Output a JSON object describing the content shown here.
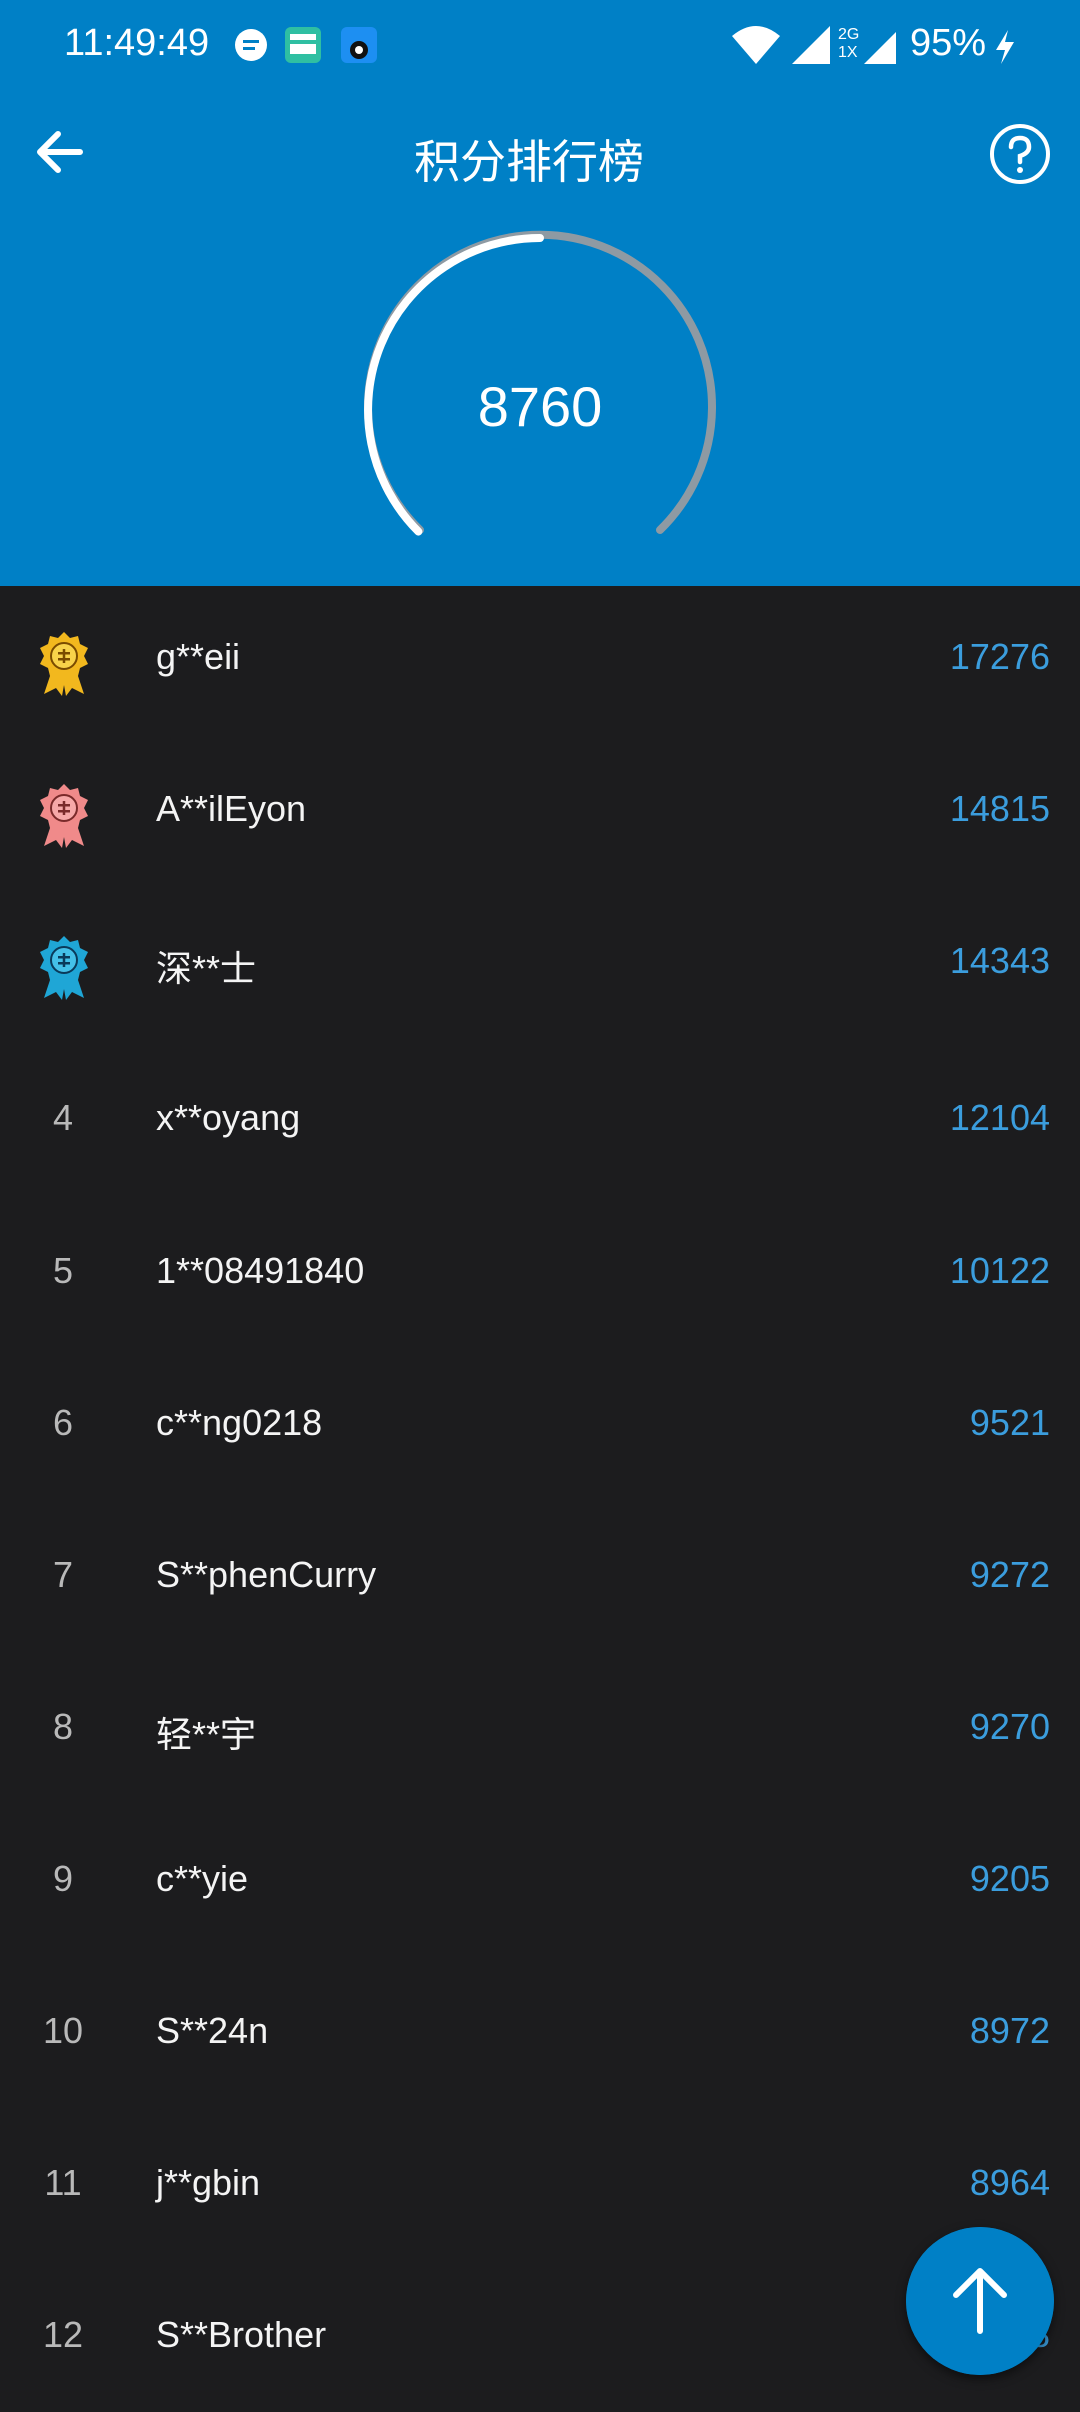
{
  "status_bar": {
    "time": "11:49:49",
    "battery": "95%",
    "network": "2G 1X",
    "icons": [
      "message-bubble-icon",
      "boss-app-icon",
      "app-618-icon",
      "wifi-icon",
      "signal-icon",
      "charging-icon"
    ]
  },
  "header": {
    "title": "积分排行榜",
    "back_icon": "arrow-left-icon",
    "help_icon": "question-circle-icon"
  },
  "score": {
    "value": "8760",
    "progress_fraction": 0.5
  },
  "leaderboard": {
    "rows": [
      {
        "rank": "1",
        "name": "g**eii",
        "points": "17276",
        "medal": "gold-medal-icon"
      },
      {
        "rank": "2",
        "name": "A**ilEyon",
        "points": "14815",
        "medal": "silver-medal-icon"
      },
      {
        "rank": "3",
        "name": "深**士",
        "points": "14343",
        "medal": "bronze-medal-icon"
      },
      {
        "rank": "4",
        "name": "x**oyang",
        "points": "12104"
      },
      {
        "rank": "5",
        "name": "1**08491840",
        "points": "10122"
      },
      {
        "rank": "6",
        "name": "c**ng0218",
        "points": "9521"
      },
      {
        "rank": "7",
        "name": "S**phenCurry",
        "points": "9272"
      },
      {
        "rank": "8",
        "name": "轻**宇",
        "points": "9270"
      },
      {
        "rank": "9",
        "name": "c**yie",
        "points": "9205"
      },
      {
        "rank": "10",
        "name": "S**24n",
        "points": "8972"
      },
      {
        "rank": "11",
        "name": "j**gbin",
        "points": "8964"
      },
      {
        "rank": "12",
        "name": "S**Brother",
        "points": "8"
      }
    ]
  },
  "fab": {
    "icon": "arrow-up-icon"
  },
  "colors": {
    "header_bg": "#0080c6",
    "list_bg": "#1c1c1e",
    "points_text": "#3b9ddd",
    "gold": "#f2b81e",
    "silver": "#f08a8a",
    "bronze": "#1fa6d6"
  }
}
